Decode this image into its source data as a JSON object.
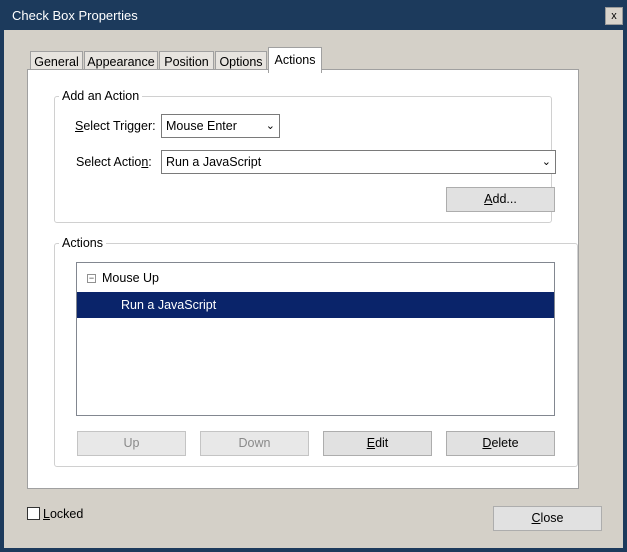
{
  "window": {
    "title": "Check Box Properties",
    "close_glyph": "x"
  },
  "tabs": [
    {
      "label": "General",
      "active": false
    },
    {
      "label": "Appearance",
      "active": false
    },
    {
      "label": "Position",
      "active": false
    },
    {
      "label": "Options",
      "active": false
    },
    {
      "label": "Actions",
      "active": true
    }
  ],
  "add_action": {
    "legend": "Add an Action",
    "trigger_label": "Select Trigger:",
    "trigger_value": "Mouse Enter",
    "action_label": "Select Action:",
    "action_value": "Run a JavaScript",
    "add_button": "Add..."
  },
  "actions": {
    "legend": "Actions",
    "tree": [
      {
        "label": "Mouse Up",
        "expander": "−",
        "selected": false
      },
      {
        "label": "Run a JavaScript",
        "selected": true
      }
    ],
    "buttons": {
      "up": "Up",
      "down": "Down",
      "edit": "Edit",
      "delete": "Delete"
    }
  },
  "footer": {
    "locked_label": "Locked",
    "locked_checked": false,
    "close_button": "Close"
  },
  "colors": {
    "titlebar": "#1c3a5c",
    "selection": "#0a246a",
    "dialog_bg": "#d4d0c8"
  }
}
